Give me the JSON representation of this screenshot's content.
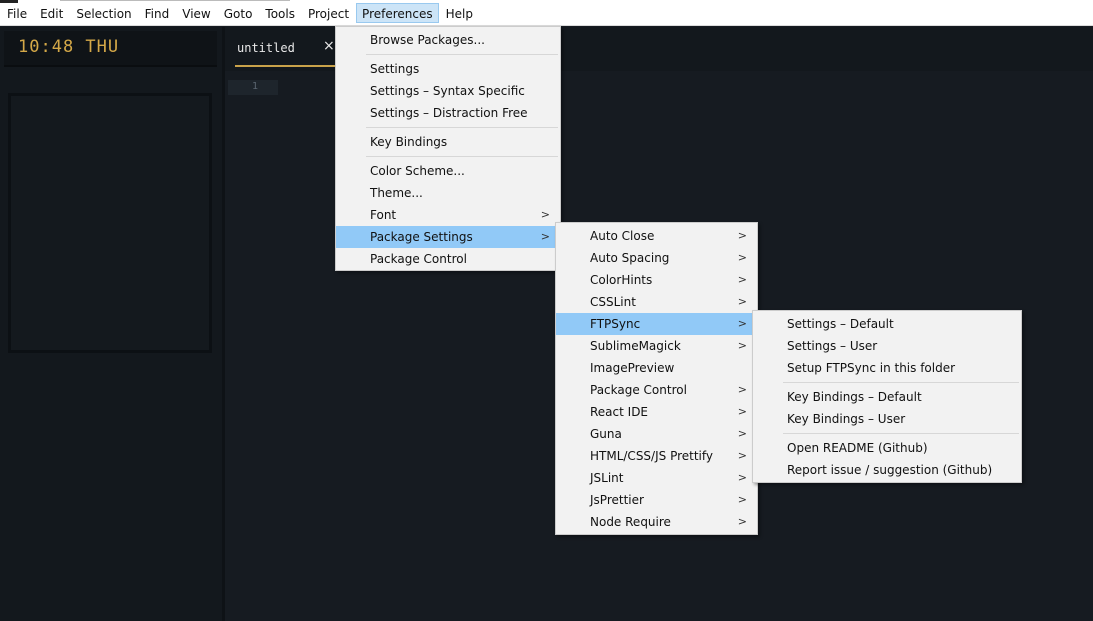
{
  "menubar": {
    "items": [
      "File",
      "Edit",
      "Selection",
      "Find",
      "View",
      "Goto",
      "Tools",
      "Project",
      "Preferences",
      "Help"
    ],
    "active": "Preferences"
  },
  "sidebar": {
    "clock": "10:48 THU"
  },
  "tabs": [
    {
      "title": "untitled",
      "close": "×"
    }
  ],
  "editor": {
    "line_numbers": [
      "1"
    ]
  },
  "preferences_menu": {
    "browse_packages": "Browse Packages...",
    "settings": "Settings",
    "settings_syntax": "Settings – Syntax Specific",
    "settings_distraction": "Settings – Distraction Free",
    "key_bindings": "Key Bindings",
    "color_scheme": "Color Scheme...",
    "theme": "Theme...",
    "font": "Font",
    "package_settings": "Package Settings",
    "package_control": "Package Control"
  },
  "package_settings_menu": {
    "items": [
      "Auto Close",
      "Auto Spacing",
      "ColorHints",
      "CSSLint",
      "FTPSync",
      "SublimeMagick",
      "ImagePreview",
      "Package Control",
      "React IDE",
      "Guna",
      "HTML/CSS/JS Prettify",
      "JSLint",
      "JsPrettier",
      "Node Require"
    ],
    "highlighted": "FTPSync"
  },
  "ftpsync_menu": {
    "settings_default": "Settings – Default",
    "settings_user": "Settings – User",
    "setup": "Setup FTPSync in this folder",
    "key_bindings_default": "Key Bindings – Default",
    "key_bindings_user": "Key Bindings – User",
    "open_readme": "Open README (Github)",
    "report_issue": "Report issue / suggestion (Github)"
  },
  "icons": {
    "submenu_arrow": "chevron-right-icon",
    "tab_close": "close-icon"
  },
  "colors": {
    "highlight": "#91c9f7",
    "clock": "#d4a848",
    "tab_accent": "#c9a24a",
    "editor_bg": "#161b21"
  }
}
